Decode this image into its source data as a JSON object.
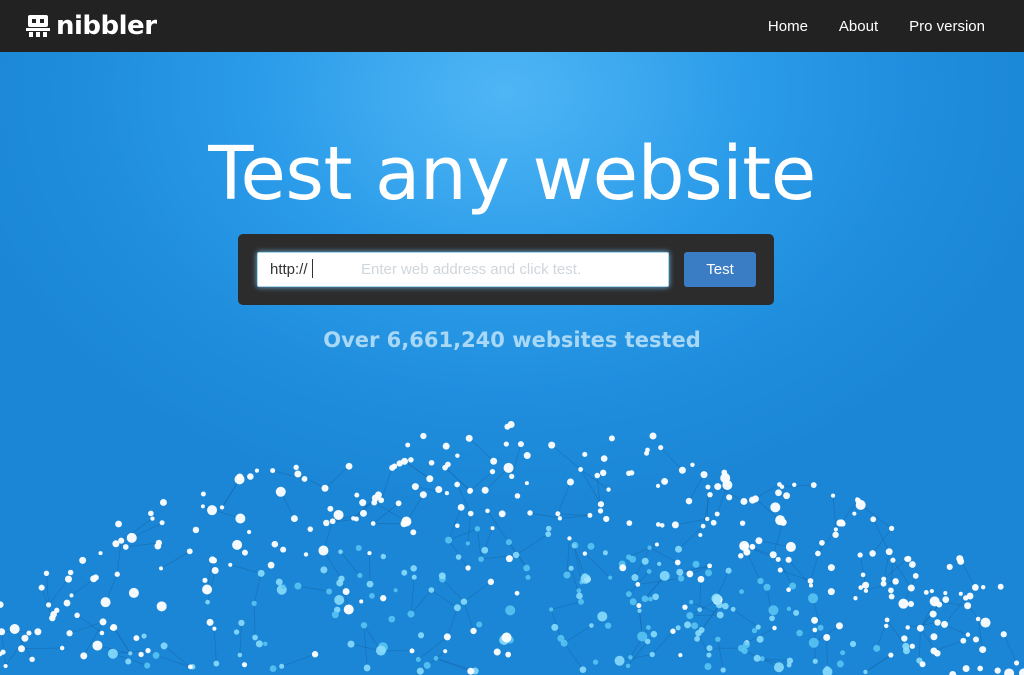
{
  "navbar": {
    "logo_text": "nibbler",
    "links": [
      "Home",
      "About",
      "Pro version"
    ]
  },
  "hero": {
    "title": "Test any website",
    "input": {
      "value": "http://",
      "placeholder": "Enter web address and click test."
    },
    "button_label": "Test",
    "counter_text": "Over 6,661,240 websites tested"
  },
  "colors": {
    "navbar_bg": "#222222",
    "hero_bg": "#1e90e0",
    "button_bg": "#3b7dc4",
    "counter_text": "#a9d8f6"
  },
  "icons": [
    "nibbler-robot-logo-icon"
  ]
}
